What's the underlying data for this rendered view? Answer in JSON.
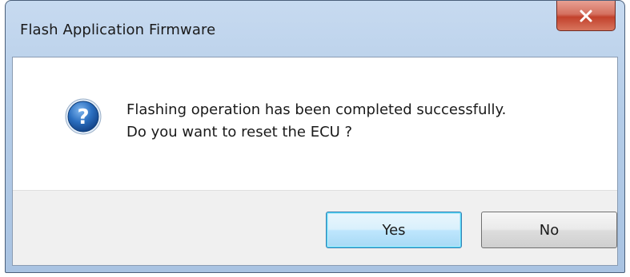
{
  "window": {
    "title": "Flash Application Firmware",
    "close_icon": "close-icon"
  },
  "message": {
    "icon": "question-icon",
    "line1": "Flashing operation has been completed successfully.",
    "line2": "Do you want to reset the ECU ?"
  },
  "buttons": {
    "yes_label": "Yes",
    "no_label": "No",
    "default": "yes"
  },
  "colors": {
    "titlebar": "#b5cde8",
    "close_button": "#c2412c",
    "icon_blue": "#1f5fa8",
    "default_button_border": "#3c7fb1",
    "button_area": "#f0f0f0"
  }
}
